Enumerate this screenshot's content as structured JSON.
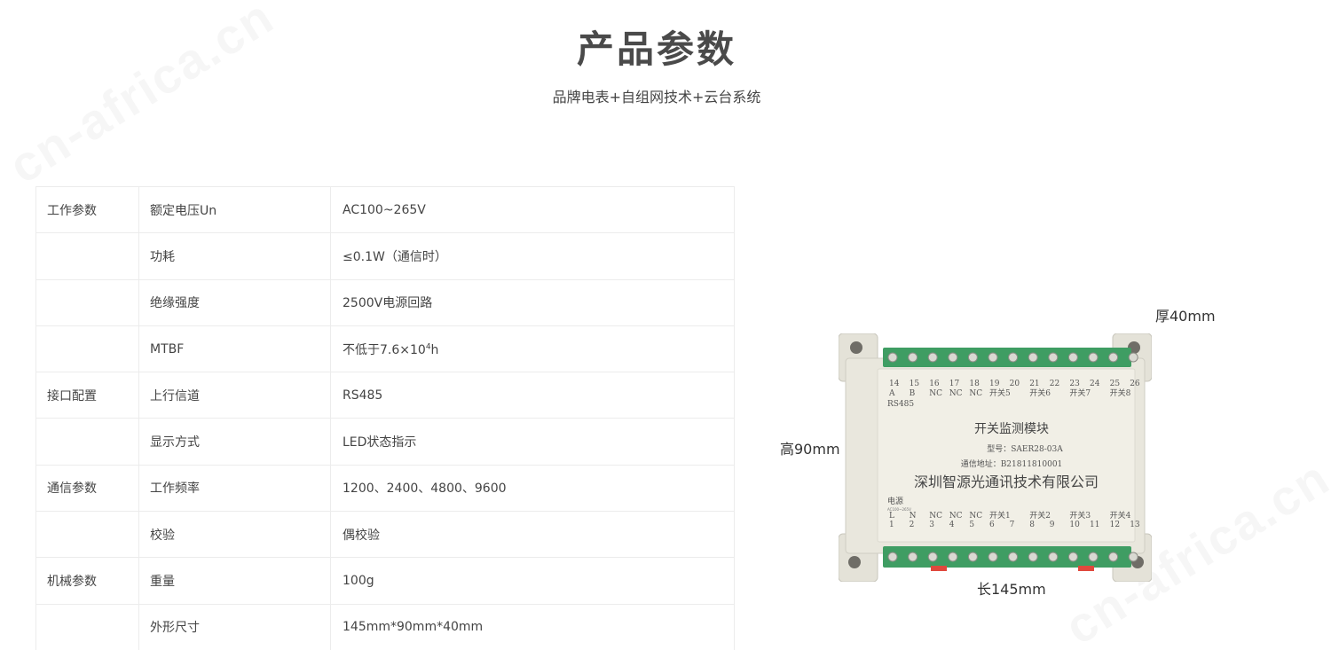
{
  "header": {
    "title": "产品参数",
    "subtitle": "品牌电表+自组网技术+云台系统"
  },
  "watermark": "cn-africa.cn",
  "table": {
    "rows": [
      {
        "group": "工作参数",
        "name": "额定电压Un",
        "value": "AC100~265V"
      },
      {
        "group": "",
        "name": "功耗",
        "value": "≤0.1W（通信时）"
      },
      {
        "group": "",
        "name": "绝缘强度",
        "value": "2500V电源回路"
      },
      {
        "group": "",
        "name": "MTBF",
        "value_prefix": "不低于7.6×10",
        "value_sup": "4",
        "value_suffix": "h"
      },
      {
        "group": "接口配置",
        "name": "上行信道",
        "value": "RS485"
      },
      {
        "group": "",
        "name": "显示方式",
        "value": "LED状态指示"
      },
      {
        "group": "通信参数",
        "name": "工作频率",
        "value": "1200、2400、4800、9600"
      },
      {
        "group": "",
        "name": "校验",
        "value": "偶校验"
      },
      {
        "group": "机械参数",
        "name": "重量",
        "value": "100g"
      },
      {
        "group": "",
        "name": "外形尺寸",
        "value": "145mm*90mm*40mm"
      }
    ]
  },
  "product": {
    "dimensions": {
      "thickness": "厚40mm",
      "height": "高90mm",
      "length": "长145mm"
    },
    "label": {
      "title": "开关监测模块",
      "model": "型号：SAER28-03A",
      "address": "通信地址：B21811810001",
      "company": "深圳智源光通讯技术有限公司",
      "power_label": "电源",
      "power_rating": "AC100~265V",
      "rs485": "RS485"
    },
    "top_terminals": [
      {
        "num": "14",
        "sig": "A"
      },
      {
        "num": "15",
        "sig": "B"
      },
      {
        "num": "16",
        "sig": "NC"
      },
      {
        "num": "17",
        "sig": "NC"
      },
      {
        "num": "18",
        "sig": "NC"
      },
      {
        "num": "19",
        "sig": "开关5"
      },
      {
        "num": "20",
        "sig": ""
      },
      {
        "num": "21",
        "sig": "开关6"
      },
      {
        "num": "22",
        "sig": ""
      },
      {
        "num": "23",
        "sig": "开关7"
      },
      {
        "num": "24",
        "sig": ""
      },
      {
        "num": "25",
        "sig": "开关8"
      },
      {
        "num": "26",
        "sig": ""
      }
    ],
    "bottom_terminals": [
      {
        "num": "1",
        "sig": "L"
      },
      {
        "num": "2",
        "sig": "N"
      },
      {
        "num": "3",
        "sig": "NC"
      },
      {
        "num": "4",
        "sig": "NC"
      },
      {
        "num": "5",
        "sig": "NC"
      },
      {
        "num": "6",
        "sig": "开关1"
      },
      {
        "num": "7",
        "sig": ""
      },
      {
        "num": "8",
        "sig": "开关2"
      },
      {
        "num": "9",
        "sig": ""
      },
      {
        "num": "10",
        "sig": "开关3"
      },
      {
        "num": "11",
        "sig": ""
      },
      {
        "num": "12",
        "sig": "开关4"
      },
      {
        "num": "13",
        "sig": ""
      }
    ],
    "colors": {
      "housing": "#e9e7dd",
      "face": "#f1efe6",
      "terminal": "#3f9d63",
      "accent": "#e0483d"
    }
  }
}
